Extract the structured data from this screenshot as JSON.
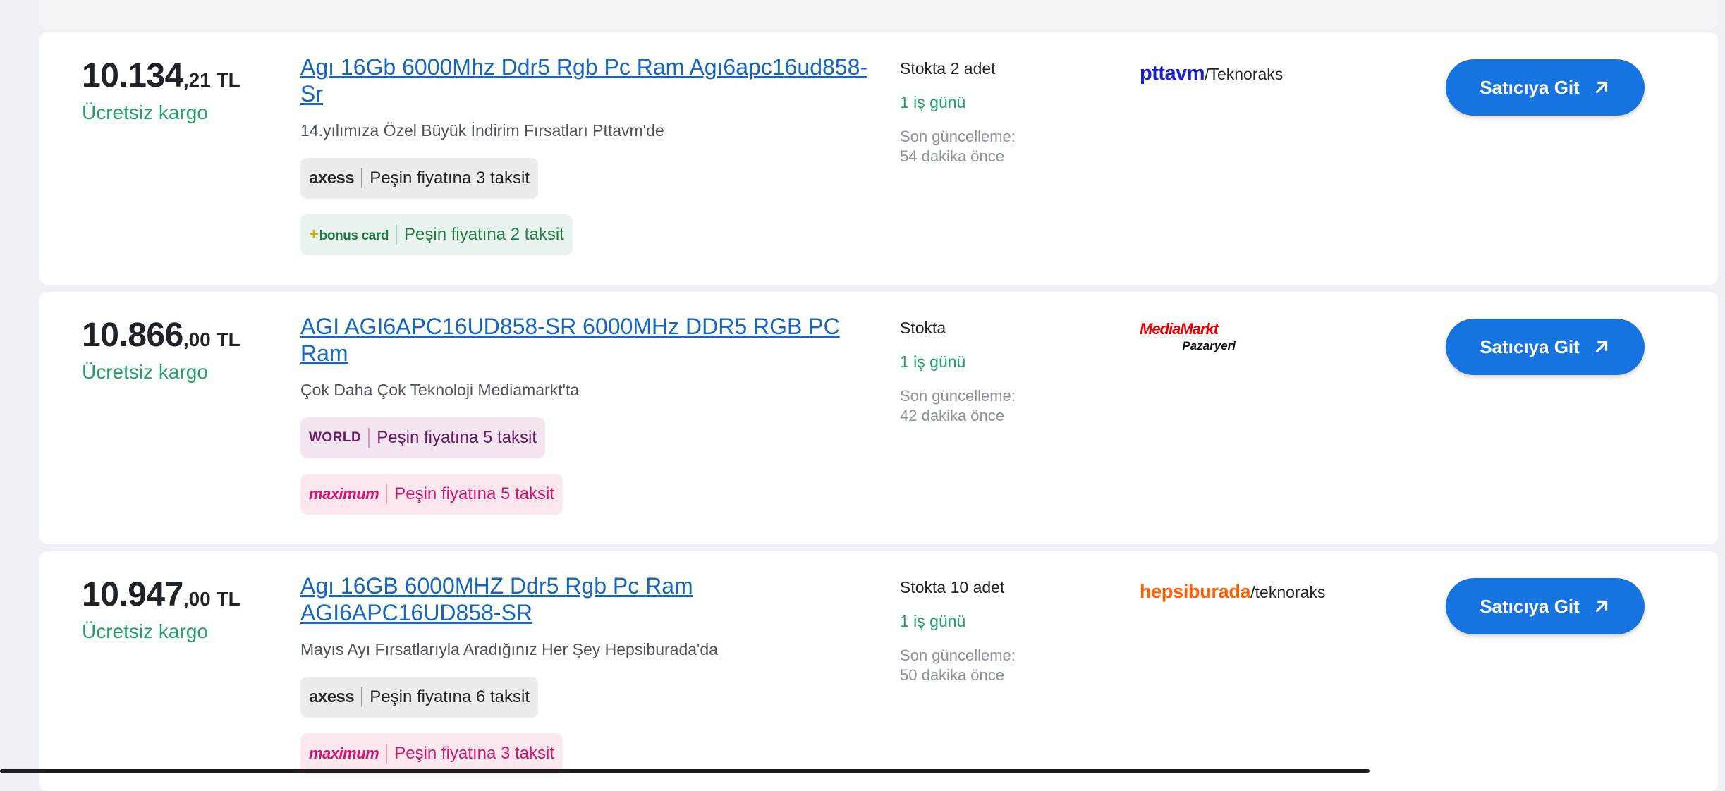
{
  "offers": [
    {
      "price_int": "10.134",
      "price_dec": ",21 TL",
      "shipping": "Ücretsiz kargo",
      "title": "Agı 16Gb 6000Mhz Ddr5 Rgb Pc Ram Agı6apc16ud858-Sr",
      "subtitle": "14.yılımıza Özel Büyük İndirim Fırsatları Pttavm'de",
      "installments": [
        {
          "card": "axess",
          "text": "Peşin fiyatına 3 taksit"
        },
        {
          "card": "bonus card",
          "text": "Peşin fiyatına 2 taksit"
        }
      ],
      "stock": "Stokta 2 adet",
      "delivery": "1 iş günü",
      "updated_label": "Son güncelleme:",
      "updated_value": "54 dakika önce",
      "seller_brand": "pttavm",
      "seller_suffix": "/Teknoraks",
      "button_label": "Satıcıya Git"
    },
    {
      "price_int": "10.866",
      "price_dec": ",00 TL",
      "shipping": "Ücretsiz kargo",
      "title": "AGI AGI6APC16UD858-SR 6000MHz DDR5 RGB PC Ram",
      "subtitle": "Çok Daha Çok Teknoloji Mediamarkt'ta",
      "installments": [
        {
          "card": "WORLD",
          "text": "Peşin fiyatına 5 taksit"
        },
        {
          "card": "maximum",
          "text": "Peşin fiyatına 5 taksit"
        }
      ],
      "stock": "Stokta",
      "delivery": "1 iş günü",
      "updated_label": "Son güncelleme:",
      "updated_value": "42 dakika önce",
      "seller_logo_line1": "MediaMarkt",
      "seller_logo_line2": "Pazaryeri",
      "button_label": "Satıcıya Git"
    },
    {
      "price_int": "10.947",
      "price_dec": ",00 TL",
      "shipping": "Ücretsiz kargo",
      "title": "Agı 16GB 6000MHZ Ddr5 Rgb Pc Ram AGI6APC16UD858-SR",
      "subtitle": "Mayıs Ayı Fırsatlarıyla Aradığınız Her Şey Hepsiburada'da",
      "installments": [
        {
          "card": "axess",
          "text": "Peşin fiyatına 6 taksit"
        },
        {
          "card": "maximum",
          "text": "Peşin fiyatına 3 taksit"
        }
      ],
      "stock": "Stokta 10 adet",
      "delivery": "1 iş günü",
      "updated_label": "Son güncelleme:",
      "updated_value": "50 dakika önce",
      "seller_brand": "hepsiburada",
      "seller_suffix": "/teknoraks",
      "button_label": "Satıcıya Git"
    }
  ],
  "colors": {
    "price": "#1e2329",
    "free_shipping": "#21a366",
    "link": "#1566c0",
    "button": "#1574e0",
    "pttavm": "#1a23c7",
    "mediamarkt": "#df0000",
    "hepsiburada": "#ff6000",
    "maximum": "#d3166d",
    "world": "#6a1960",
    "bonus": "#1f7a45"
  },
  "icons": {
    "button_arrow": "arrow-up-right-icon"
  }
}
